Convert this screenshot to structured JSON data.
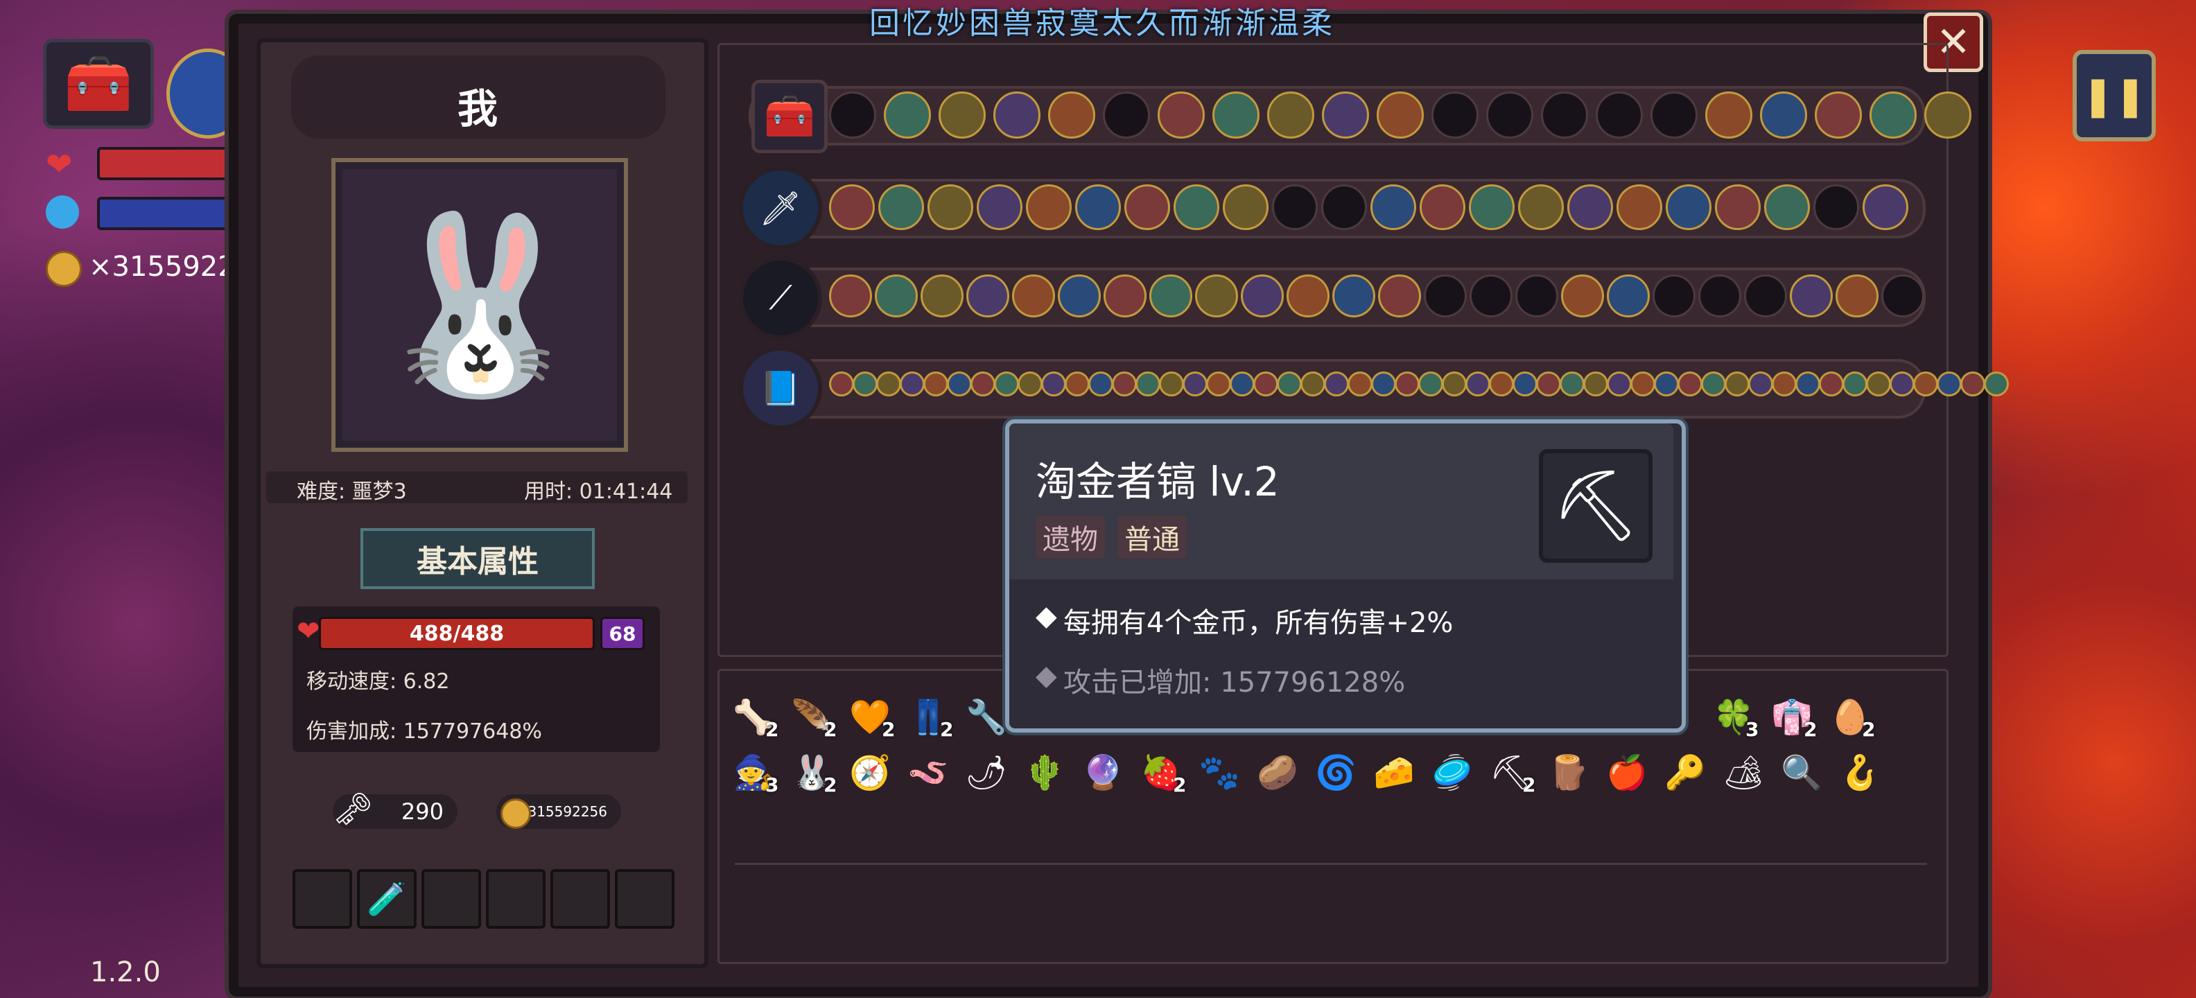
{
  "window_title": "回忆妙困兽寂寞太久而渐渐温柔",
  "hud": {
    "gold_count": "×3155922",
    "version": "1.2.0"
  },
  "character": {
    "name": "我",
    "difficulty": "难度: 噩梦3",
    "time": "用时: 01:41:44",
    "tab_label": "基本属性",
    "hp": "488/488",
    "level": "68",
    "move_speed": "移动速度: 6.82",
    "damage_bonus": "伤害加成: 157797648%",
    "keys": "290",
    "coins": "315592256"
  },
  "item_grid": [
    {
      "icon": "🦴",
      "count": "2"
    },
    {
      "icon": "🪶",
      "count": "2"
    },
    {
      "icon": "🧡",
      "count": "2"
    },
    {
      "icon": "👖",
      "count": "2"
    },
    {
      "icon": "🔧",
      "count": ""
    },
    {
      "icon": "🍀",
      "count": "3"
    },
    {
      "icon": "👘",
      "count": "2"
    },
    {
      "icon": "🥚",
      "count": "2"
    },
    {
      "icon": "🧙",
      "count": "3"
    },
    {
      "icon": "🐰",
      "count": "2"
    },
    {
      "icon": "🧭",
      "count": ""
    },
    {
      "icon": "🪱",
      "count": ""
    },
    {
      "icon": "🌶",
      "count": ""
    },
    {
      "icon": "🌵",
      "count": ""
    },
    {
      "icon": "🔮",
      "count": ""
    },
    {
      "icon": "🍓",
      "count": "2"
    },
    {
      "icon": "🐾",
      "count": ""
    },
    {
      "icon": "🥔",
      "count": ""
    },
    {
      "icon": "🌀",
      "count": ""
    },
    {
      "icon": "🧀",
      "count": ""
    },
    {
      "icon": "🥏",
      "count": ""
    },
    {
      "icon": "⛏",
      "count": "2"
    },
    {
      "icon": "🪵",
      "count": ""
    },
    {
      "icon": "🍎",
      "count": ""
    },
    {
      "icon": "🔑",
      "count": ""
    },
    {
      "icon": "🏕",
      "count": ""
    },
    {
      "icon": "🔍",
      "count": ""
    },
    {
      "icon": "🪝",
      "count": ""
    }
  ],
  "tooltip": {
    "title": "淘金者镐 lv.2",
    "tag_type": "遗物",
    "tag_rarity": "普通",
    "desc1": "每拥有4个金币，所有伤害+2%",
    "desc2": "攻击已增加: 157796128%",
    "icon": "pickaxe-icon"
  },
  "colors": {
    "hp": "#b42a22",
    "mp": "#2d3fa0",
    "accent_gold": "#c29a3c",
    "tooltip_border": "#8aa0b6"
  }
}
